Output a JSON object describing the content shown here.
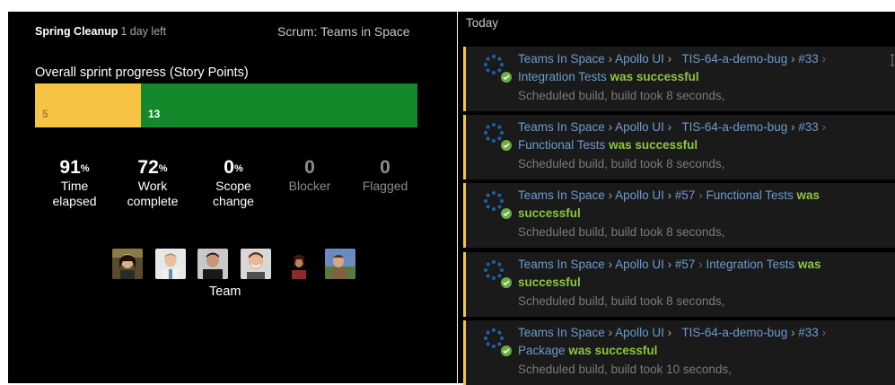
{
  "sprint": {
    "name": "Spring Cleanup",
    "days_left": "1 day left",
    "board": "Scrum: Teams in Space",
    "progress_title": "Overall sprint progress (Story Points)",
    "progress": {
      "yellow_value": "5",
      "green_value": "13",
      "yellow_fraction": 0.277,
      "yellow_color": "#f6c342",
      "green_color": "#14892c"
    }
  },
  "stats": [
    {
      "value": "91",
      "unit": "%",
      "label1": "Time",
      "label2": "elapsed",
      "dim": false
    },
    {
      "value": "72",
      "unit": "%",
      "label1": "Work",
      "label2": "complete",
      "dim": false
    },
    {
      "value": "0",
      "unit": "%",
      "label1": "Scope",
      "label2": "change",
      "dim": false
    },
    {
      "value": "0",
      "unit": "",
      "label1": "Blocker",
      "label2": "",
      "dim": true
    },
    {
      "value": "0",
      "unit": "",
      "label1": "Flagged",
      "label2": "",
      "dim": true
    }
  ],
  "team": {
    "label": "Team",
    "avatar_count": 6
  },
  "feed": {
    "heading": "Today",
    "items": [
      {
        "project": "Teams In Space",
        "plan": "Apollo UI",
        "branch": "TIS-64-a-demo-bug",
        "build": "#33",
        "job": "Integration Tests",
        "status": "was successful",
        "detail": "Scheduled build, build took 8 seconds,"
      },
      {
        "project": "Teams In Space",
        "plan": "Apollo UI",
        "branch": "TIS-64-a-demo-bug",
        "build": "#33",
        "job": "Functional Tests",
        "status": "was successful",
        "detail": "Scheduled build, build took 8 seconds,"
      },
      {
        "project": "Teams In Space",
        "plan": "Apollo UI",
        "branch": "",
        "build": "#57",
        "job": "Functional Tests",
        "status_a": "was",
        "status_b": "successful",
        "detail": "Scheduled build, build took 8 seconds,"
      },
      {
        "project": "Teams In Space",
        "plan": "Apollo UI",
        "branch": "",
        "build": "#57",
        "job": "Integration Tests",
        "status_a": "was",
        "status_b": "successful",
        "detail": "Scheduled build, build took 8 seconds,"
      },
      {
        "project": "Teams In Space",
        "plan": "Apollo UI",
        "branch": "TIS-64-a-demo-bug",
        "build": "#33",
        "job": "Package",
        "status": "was successful",
        "detail": "Scheduled build, build took 10 seconds,"
      }
    ]
  },
  "separator": "›",
  "colors": {
    "success": "#8dc63f",
    "link": "#6b9bd0",
    "accent": "#f6c342"
  }
}
